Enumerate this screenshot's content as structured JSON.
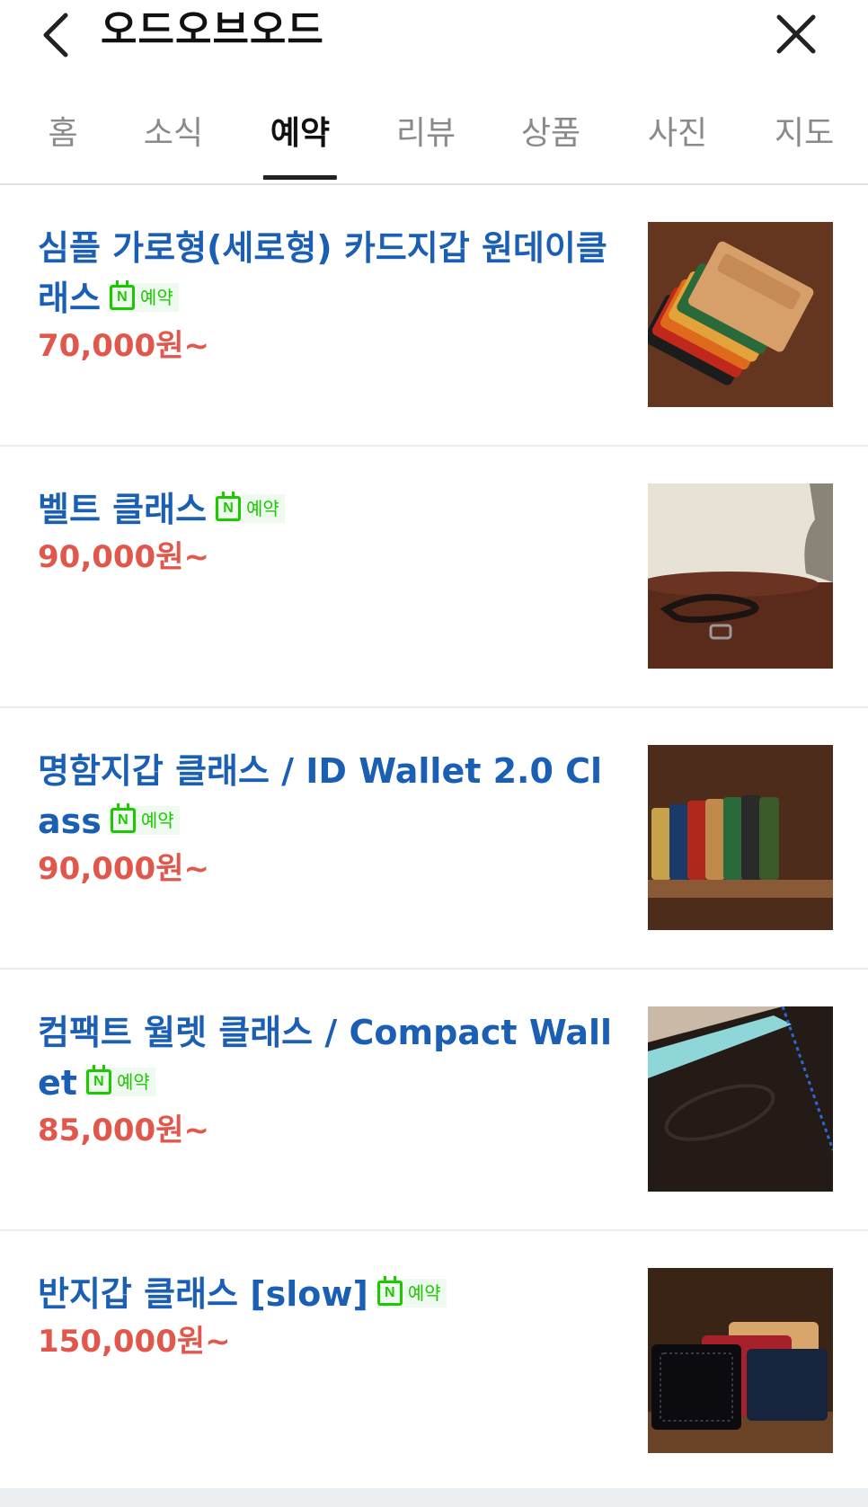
{
  "header": {
    "title": "오드오브오드",
    "back_icon": "chevron-left-icon",
    "close_icon": "close-icon"
  },
  "tabs": [
    {
      "label": "홈",
      "active": false
    },
    {
      "label": "소식",
      "active": false
    },
    {
      "label": "예약",
      "active": true
    },
    {
      "label": "리뷰",
      "active": false
    },
    {
      "label": "상품",
      "active": false
    },
    {
      "label": "사진",
      "active": false
    },
    {
      "label": "지도",
      "active": false
    }
  ],
  "badge": {
    "icon": "naver-calendar-icon",
    "icon_letter": "N",
    "label": "예약",
    "color": "#1ec800"
  },
  "items": [
    {
      "title": "심플 가로형(세로형) 카드지갑 원데이클래스",
      "price": "70,000원~"
    },
    {
      "title": "벨트 클래스",
      "price": "90,000원~"
    },
    {
      "title": "명함지갑 클래스 / ID Wallet 2.0 Class",
      "price": "90,000원~"
    },
    {
      "title": "컴팩트 월렛 클래스 / Compact Wallet",
      "price": "85,000원~"
    },
    {
      "title": "반지갑 클래스 [slow]",
      "price": "150,000원~"
    }
  ],
  "colors": {
    "title_blue": "#1a5fb4",
    "price_red": "#e2574c",
    "accent_green": "#1ec800"
  }
}
